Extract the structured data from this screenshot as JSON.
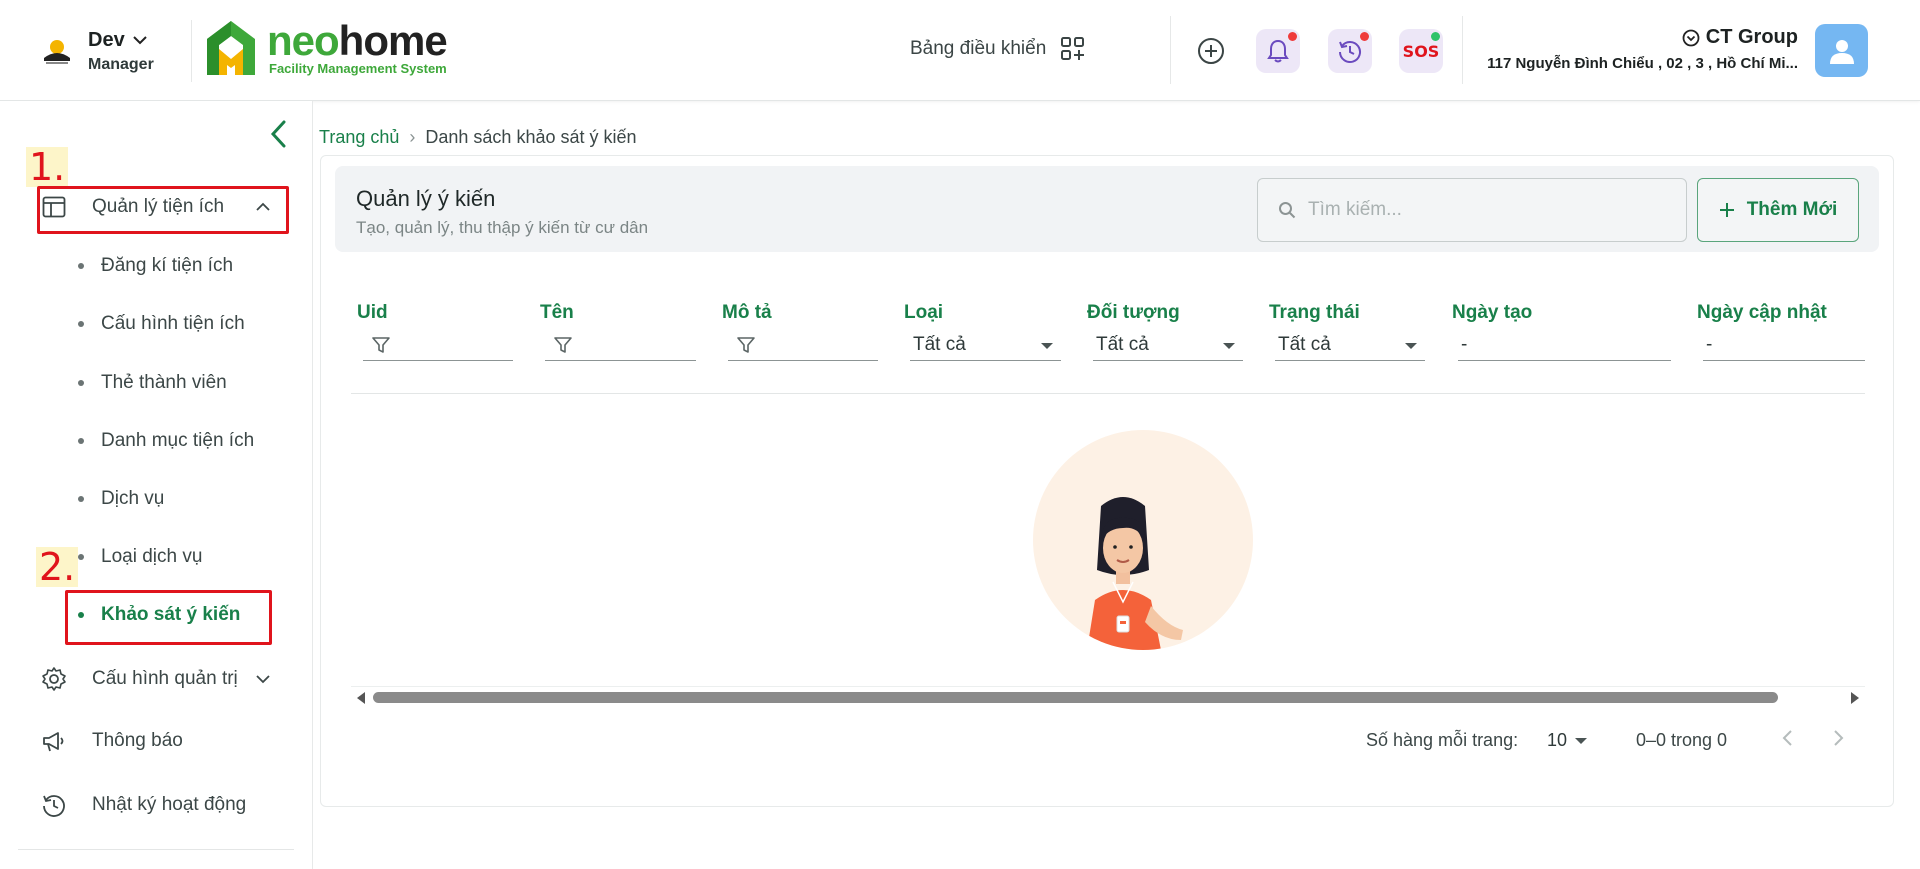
{
  "header": {
    "user": {
      "name": "Dev",
      "role": "Manager",
      "logo_icon": "company-logo-icon"
    },
    "brand": {
      "name_part1": "neo",
      "name_part2": "home",
      "subtitle": "Facility Management System"
    },
    "dashboard_label": "Bảng điều khiển",
    "icons": [
      "add-circle-icon",
      "bell-icon",
      "history-icon",
      "sos-icon"
    ],
    "sos_text": "SOS",
    "company": {
      "name": "CT Group",
      "address": "117 Nguyễn Đình Chiểu , 02 , 3 , Hồ Chí Mi..."
    }
  },
  "sidebar": {
    "group_utilities": {
      "label": "Quản lý tiện ích",
      "icon": "layout-icon"
    },
    "sub_items": [
      "Đăng kí tiện ích",
      "Cấu hình tiện ích",
      "Thẻ thành viên",
      "Danh mục tiện ích",
      "Dịch vụ",
      "Loại dịch vụ",
      "Khảo sát ý kiến"
    ],
    "active_item": "Khảo sát ý kiến",
    "group_admin": {
      "label": "Cấu hình quản trị",
      "icon": "gear-icon"
    },
    "notifications": {
      "label": "Thông báo",
      "icon": "megaphone-icon"
    },
    "activity_log": {
      "label": "Nhật ký hoạt động",
      "icon": "history-icon"
    },
    "annotations": {
      "first": "1.",
      "second": "2."
    }
  },
  "breadcrumb": {
    "home": "Trang chủ",
    "separator": "›",
    "current": "Danh sách khảo sát ý kiến"
  },
  "panel": {
    "title": "Quản lý ý kiến",
    "subtitle": "Tạo, quản lý, thu thập ý kiến từ cư dân",
    "search_placeholder": "Tìm kiếm...",
    "add_button": "Thêm Mới"
  },
  "table": {
    "columns": [
      "Uid",
      "Tên",
      "Mô tả",
      "Loại",
      "Đối tượng",
      "Trạng thái",
      "Ngày tạo",
      "Ngày cập nhật"
    ],
    "filters": {
      "type": "Tất cả",
      "target": "Tất cả",
      "status": "Tất cả",
      "created": "-",
      "updated": "-"
    },
    "rows": []
  },
  "pagination": {
    "rows_per_page_label": "Số hàng mỗi trang:",
    "rows_per_page": "10",
    "range": "0–0 trong 0"
  },
  "colors": {
    "primary_green": "#19804a",
    "brand_green": "#3ea83a",
    "annotation_red": "#e0141c",
    "notification_dot": "#ef3b3b",
    "online_dot": "#2fc36a"
  }
}
